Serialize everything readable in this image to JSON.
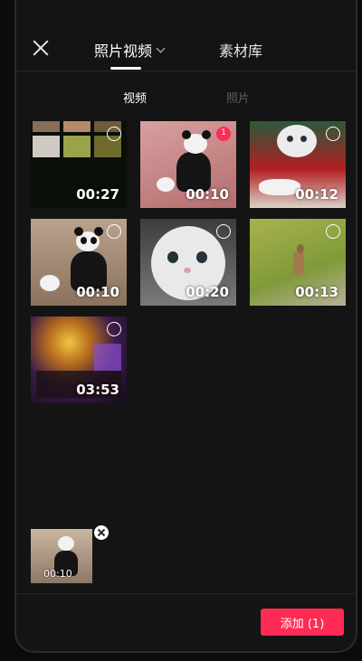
{
  "header": {
    "tab_photos_videos": "照片视频",
    "tab_library": "素材库"
  },
  "subtabs": {
    "video": "视频",
    "photo": "照片"
  },
  "grid": [
    {
      "duration": "00:27",
      "selected": false
    },
    {
      "duration": "00:10",
      "selected": true,
      "order": "1"
    },
    {
      "duration": "00:12",
      "selected": false
    },
    {
      "duration": "00:10",
      "selected": false
    },
    {
      "duration": "00:20",
      "selected": false
    },
    {
      "duration": "00:13",
      "selected": false
    },
    {
      "duration": "03:53",
      "selected": false
    }
  ],
  "selected_tray": [
    {
      "duration": "00:10"
    }
  ],
  "footer": {
    "add_button": "添加 (1)"
  },
  "colors": {
    "accent": "#fe2c55",
    "background": "#141414"
  }
}
